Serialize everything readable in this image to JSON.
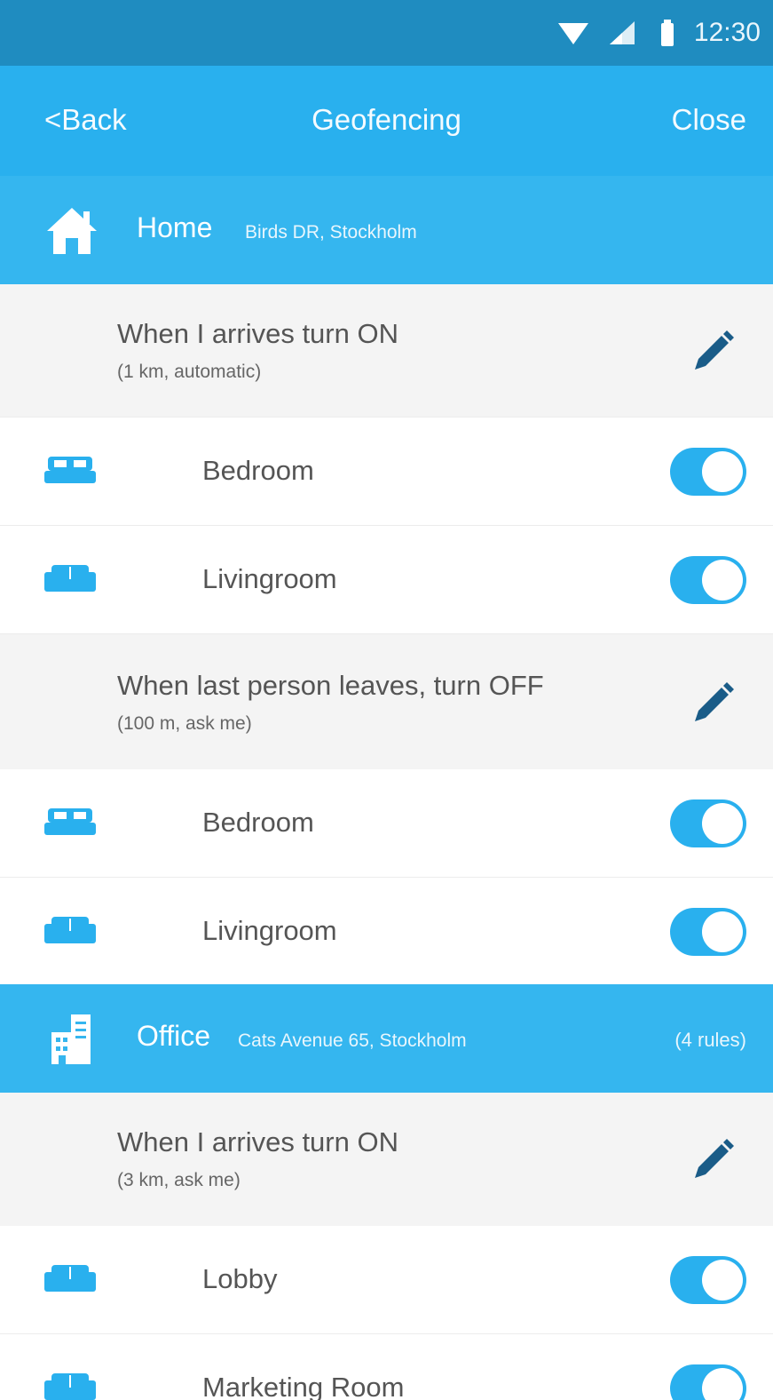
{
  "status_bar": {
    "time": "12:30",
    "icons": [
      "wifi-icon",
      "cell-signal-icon",
      "battery-icon"
    ]
  },
  "app_bar": {
    "back_label": "<Back",
    "title": "Geofencing",
    "close_label": "Close"
  },
  "colors": {
    "status_bar": "#1f8cc0",
    "app_bar": "#29b0ee",
    "section_header": "#35b6ef",
    "accent": "#29b0ee",
    "rule_background": "#f4f4f4",
    "edit_icon": "#1a5c88"
  },
  "locations": [
    {
      "icon": "house-icon",
      "name": "Home",
      "address": "Birds DR, Stockholm",
      "rule_count": "",
      "rules": [
        {
          "title": "When I arrives turn ON",
          "subtitle": "(1 km, automatic)",
          "rooms": [
            {
              "icon": "bed-icon",
              "label": "Bedroom",
              "enabled": true
            },
            {
              "icon": "sofa-icon",
              "label": "Livingroom",
              "enabled": true
            }
          ]
        },
        {
          "title": "When last person leaves, turn OFF",
          "subtitle": "(100 m, ask me)",
          "rooms": [
            {
              "icon": "bed-icon",
              "label": "Bedroom",
              "enabled": true
            },
            {
              "icon": "sofa-icon",
              "label": "Livingroom",
              "enabled": true
            }
          ]
        }
      ]
    },
    {
      "icon": "office-building-icon",
      "name": "Office",
      "address": "Cats Avenue 65, Stockholm",
      "rule_count": "(4 rules)",
      "rules": [
        {
          "title": "When I arrives turn ON",
          "subtitle": "(3 km, ask me)",
          "rooms": [
            {
              "icon": "sofa-icon",
              "label": "Lobby",
              "enabled": true
            },
            {
              "icon": "sofa-icon",
              "label": "Marketing Room",
              "enabled": true
            }
          ]
        }
      ]
    }
  ]
}
